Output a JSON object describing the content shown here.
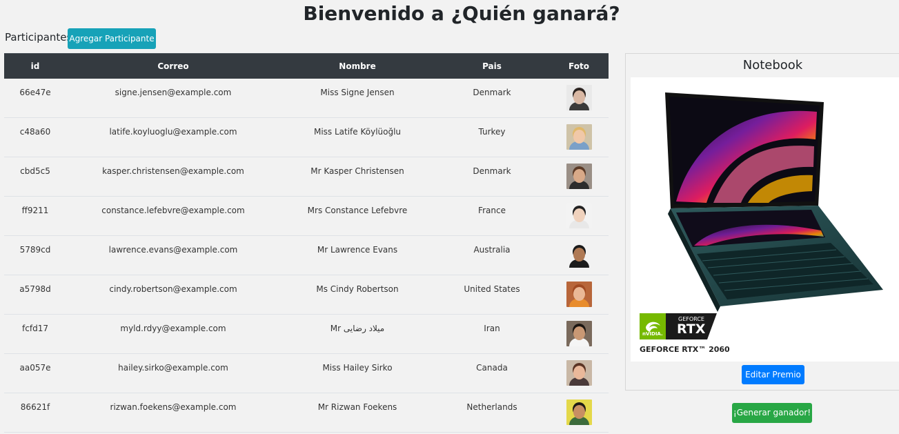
{
  "page": {
    "title": "Bienvenido a ¿Quién ganará?"
  },
  "participants": {
    "section_label": "Participantes",
    "add_button": "Agregar Participante",
    "columns": [
      "id",
      "Correo",
      "Nombre",
      "Pais",
      "Foto"
    ],
    "rows": [
      {
        "id": "66e47e",
        "email": "signe.jensen@example.com",
        "name": "Miss Signe Jensen",
        "country": "Denmark",
        "photo": {
          "bg": "#e9e9e9",
          "skin": "#d9b8a4",
          "hair": "#2b2320",
          "shirt": "#3a3a3a"
        }
      },
      {
        "id": "c48a60",
        "email": "latife.koyluoglu@example.com",
        "name": "Miss Latife Köylüoğlu",
        "country": "Turkey",
        "photo": {
          "bg": "#cfc3a8",
          "skin": "#f0c8a8",
          "hair": "#e0b86a",
          "shirt": "#7aa0c8"
        }
      },
      {
        "id": "cbd5c5",
        "email": "kasper.christensen@example.com",
        "name": "Mr Kasper Christensen",
        "country": "Denmark",
        "photo": {
          "bg": "#9a8f86",
          "skin": "#d8a988",
          "hair": "#5b3a26",
          "shirt": "#2c2c2c"
        }
      },
      {
        "id": "ff9211",
        "email": "constance.lefebvre@example.com",
        "name": "Mrs Constance Lefebvre",
        "country": "France",
        "photo": {
          "bg": "#f3f3f3",
          "skin": "#f0d2bd",
          "hair": "#222222",
          "shirt": "#e8e8e8"
        }
      },
      {
        "id": "5789cd",
        "email": "lawrence.evans@example.com",
        "name": "Mr Lawrence Evans",
        "country": "Australia",
        "photo": {
          "bg": "#f2f2f2",
          "skin": "#b07a55",
          "hair": "#1a1a1a",
          "shirt": "#1c1c1c"
        }
      },
      {
        "id": "a5798d",
        "email": "cindy.robertson@example.com",
        "name": "Ms Cindy Robertson",
        "country": "United States",
        "photo": {
          "bg": "#b8663a",
          "skin": "#eab896",
          "hair": "#a14a22",
          "shirt": "#e88c2c"
        }
      },
      {
        "id": "fcfd17",
        "email": "myld.rdyy@example.com",
        "name": "Mr میلاد رضایی",
        "country": "Iran",
        "photo": {
          "bg": "#7a6a5c",
          "skin": "#c99874",
          "hair": "#1b1511",
          "shirt": "#f5f5f5"
        }
      },
      {
        "id": "aa057e",
        "email": "hailey.sirko@example.com",
        "name": "Miss Hailey Sirko",
        "country": "Canada",
        "photo": {
          "bg": "#c9b8a6",
          "skin": "#e9b89a",
          "hair": "#5a3424",
          "shirt": "#4a3a3a"
        }
      },
      {
        "id": "86621f",
        "email": "rizwan.foekens@example.com",
        "name": "Mr Rizwan Foekens",
        "country": "Netherlands",
        "photo": {
          "bg": "#e4d84a",
          "skin": "#c88f63",
          "hair": "#1e1a16",
          "shirt": "#3c6b3c"
        }
      }
    ]
  },
  "prize": {
    "title": "Notebook",
    "badge_brand": "nVIDIA.",
    "badge_line1": "GEFORCE",
    "badge_line2": "RTX",
    "caption": "GEFORCE RTX™ 2060",
    "edit_button": "Editar Premio"
  },
  "actions": {
    "generate_button": "¡Generar ganador!"
  },
  "colors": {
    "table_header_bg": "#343a40",
    "add_button": "#17a2b8",
    "edit_button": "#007bff",
    "generate_button": "#28a745",
    "nvidia_green": "#76b900"
  }
}
